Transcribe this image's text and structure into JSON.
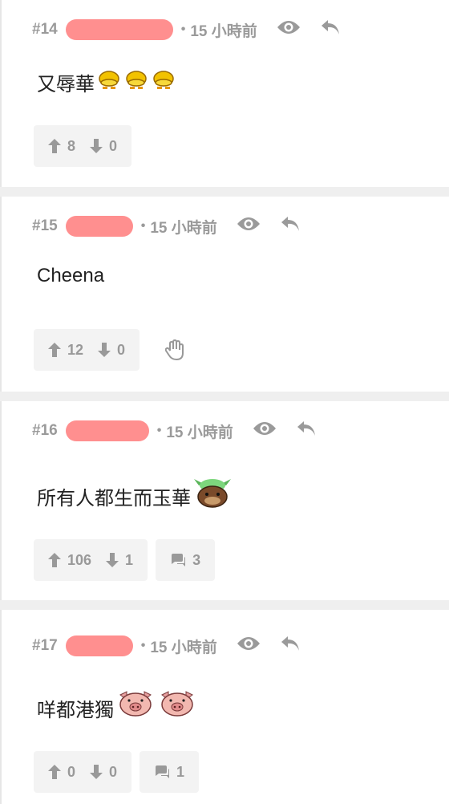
{
  "posts": [
    {
      "number": "#14",
      "time": "15 小時前",
      "content": "又辱華",
      "emojis": [
        "duck-icon",
        "duck-icon",
        "duck-icon"
      ],
      "upvotes": "8",
      "downvotes": "0",
      "comments": null,
      "flag": false
    },
    {
      "number": "#15",
      "time": "15 小時前",
      "content": "Cheena",
      "emojis": [],
      "upvotes": "12",
      "downvotes": "0",
      "comments": null,
      "flag": true
    },
    {
      "number": "#16",
      "time": "15 小時前",
      "content": "所有人都生而玉華",
      "emojis": [
        "horned-monster-icon"
      ],
      "upvotes": "106",
      "downvotes": "1",
      "comments": "3",
      "flag": false
    },
    {
      "number": "#17",
      "time": "15 小時前",
      "content": "咩都港獨",
      "emojis": [
        "pig-icon",
        "pig-icon"
      ],
      "upvotes": "0",
      "downvotes": "0",
      "comments": "1",
      "flag": false
    }
  ],
  "colors": {
    "meta_gray": "#9a9a9a",
    "redaction": "#ff8f8f",
    "button_bg": "#f3f3f3"
  },
  "meta_separator": "•"
}
